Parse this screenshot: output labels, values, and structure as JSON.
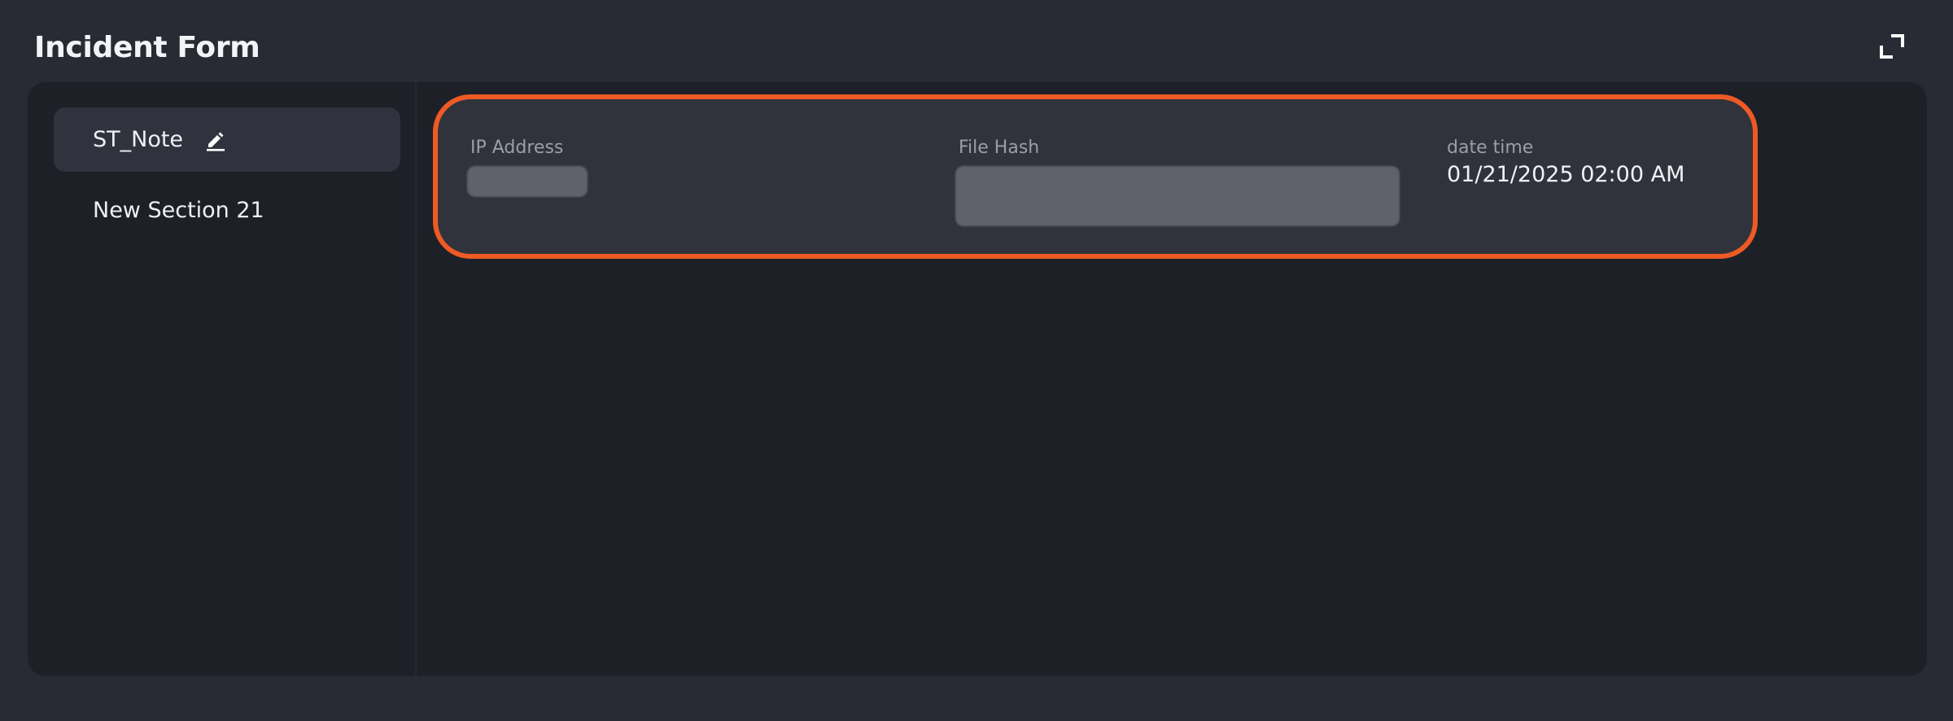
{
  "header": {
    "title": "Incident Form"
  },
  "sidebar": {
    "items": [
      {
        "label": "ST_Note",
        "active": true,
        "editable": true
      },
      {
        "label": "New Section 21",
        "active": false,
        "editable": false
      }
    ]
  },
  "fields": [
    {
      "label": "IP Address",
      "value_redacted": true
    },
    {
      "label": "File Hash",
      "value_redacted": true
    },
    {
      "label": "date time",
      "value": "01/21/2025 02:00 AM"
    }
  ],
  "colors": {
    "highlight": "#ee5a24",
    "background": "#282b34",
    "panel": "#1e2028",
    "card": "#30333c"
  },
  "icons": {
    "expand": "expand-icon",
    "edit": "pencil-icon"
  }
}
